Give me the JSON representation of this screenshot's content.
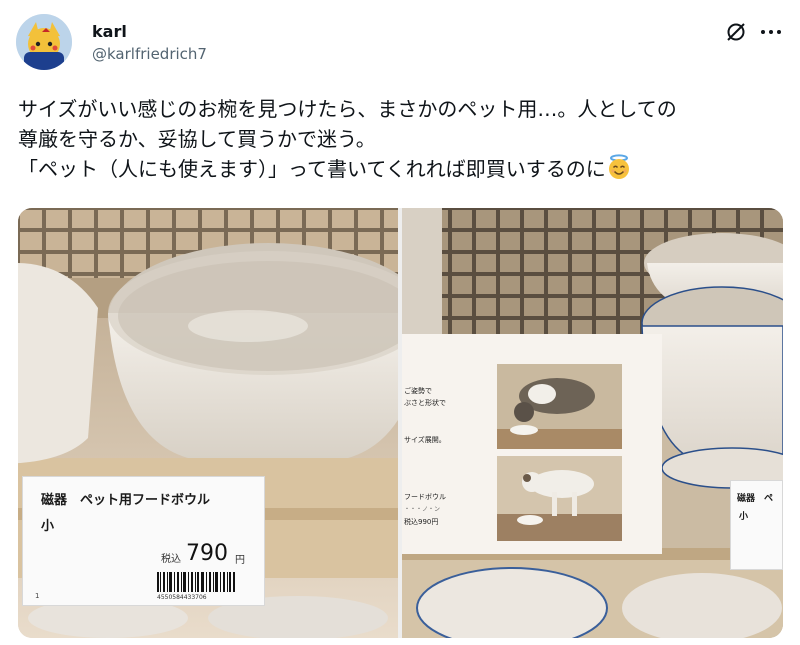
{
  "author": {
    "display_name": "karl",
    "handle": "@karlfriedrich7",
    "avatar_icon": "avatar-anime-character"
  },
  "header_actions": {
    "grok_icon": "grok-slash-circle-icon",
    "more_icon": "more-dots-icon"
  },
  "tweet": {
    "line1": "サイズがいい感じのお椀を見つけたら、まさかのペット用…。人としての",
    "line2": "尊厳を守るか、妥協して買うかで迷う。",
    "line3": "「ペット（人にも使えます）」って書いてくれれば即買いするのに",
    "emoji": "smiling-face-with-halo"
  },
  "photo_left": {
    "tag_title": "磁器　ペット用フードボウル",
    "tag_size": "小",
    "tag_tax": "税込",
    "tag_price": "790",
    "tag_yen": "円",
    "barcode_number": "4550584433706",
    "tag_index": "1"
  },
  "photo_right": {
    "sign_lines": [
      "ご姿勢で",
      "ぶさと形状で",
      "",
      "サイズ展開。"
    ],
    "sign_bottom_title": "フードボウル",
    "sign_bottom_sub": "・・・ノ・ン",
    "sign_price": "税込990円",
    "tag_title": "磁器　ペ",
    "tag_size": "小"
  },
  "colors": {
    "text_primary": "#0f1419",
    "text_secondary": "#536471",
    "bowl_rim_blue": "#2b4f8a"
  }
}
